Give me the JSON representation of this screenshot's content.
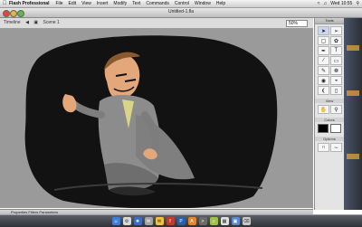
{
  "menubar": {
    "app_name": "Flash Professional",
    "items": [
      "File",
      "Edit",
      "View",
      "Insert",
      "Modify",
      "Text",
      "Commands",
      "Control",
      "Window",
      "Help"
    ],
    "clock": "Wed 10:55"
  },
  "window": {
    "title": "Untitled-1.fla"
  },
  "toolbar": {
    "timeline_label": "Timeline",
    "scene_label": "Scene 1",
    "zoom_value": "50%"
  },
  "tools_panel": {
    "title": "Tools",
    "view_label": "View",
    "colors_label": "Colors",
    "options_label": "Options"
  },
  "properties_bar": {
    "label": "Properties  Filters  Parameters"
  }
}
